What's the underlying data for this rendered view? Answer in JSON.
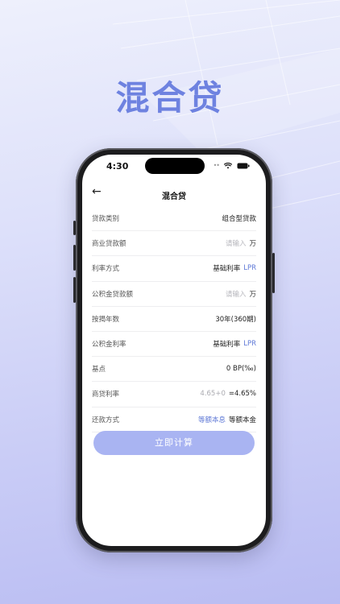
{
  "headline": "混合贷",
  "status_bar": {
    "time": "4:30"
  },
  "nav": {
    "title": "混合贷",
    "back_icon": "arrow-left-icon"
  },
  "form": {
    "loan_type": {
      "label": "贷款类别",
      "value": "组合型贷款"
    },
    "commercial_amount": {
      "label": "商业贷款额",
      "placeholder": "请输入",
      "unit": "万"
    },
    "rate_method": {
      "label": "利率方式",
      "option_a": "基础利率",
      "option_b": "LPR"
    },
    "fund_amount": {
      "label": "公积金贷款额",
      "placeholder": "请输入",
      "unit": "万"
    },
    "years": {
      "label": "按揭年数",
      "value": "30年(360期)"
    },
    "fund_rate": {
      "label": "公积金利率",
      "option_a": "基础利率",
      "option_b": "LPR"
    },
    "basis_point": {
      "label": "基点",
      "value": "0 BP(‰)"
    },
    "commercial_rate": {
      "label": "商贷利率",
      "formula": "4.65+0",
      "result": "=4.65%"
    },
    "repay_method": {
      "label": "还款方式",
      "option_a": "等额本息",
      "option_b": "等额本金"
    }
  },
  "calculate_button": "立即计算",
  "colors": {
    "accent": "#5e78d6",
    "button": "#a9b4f2",
    "headline": "#6e82e0"
  }
}
